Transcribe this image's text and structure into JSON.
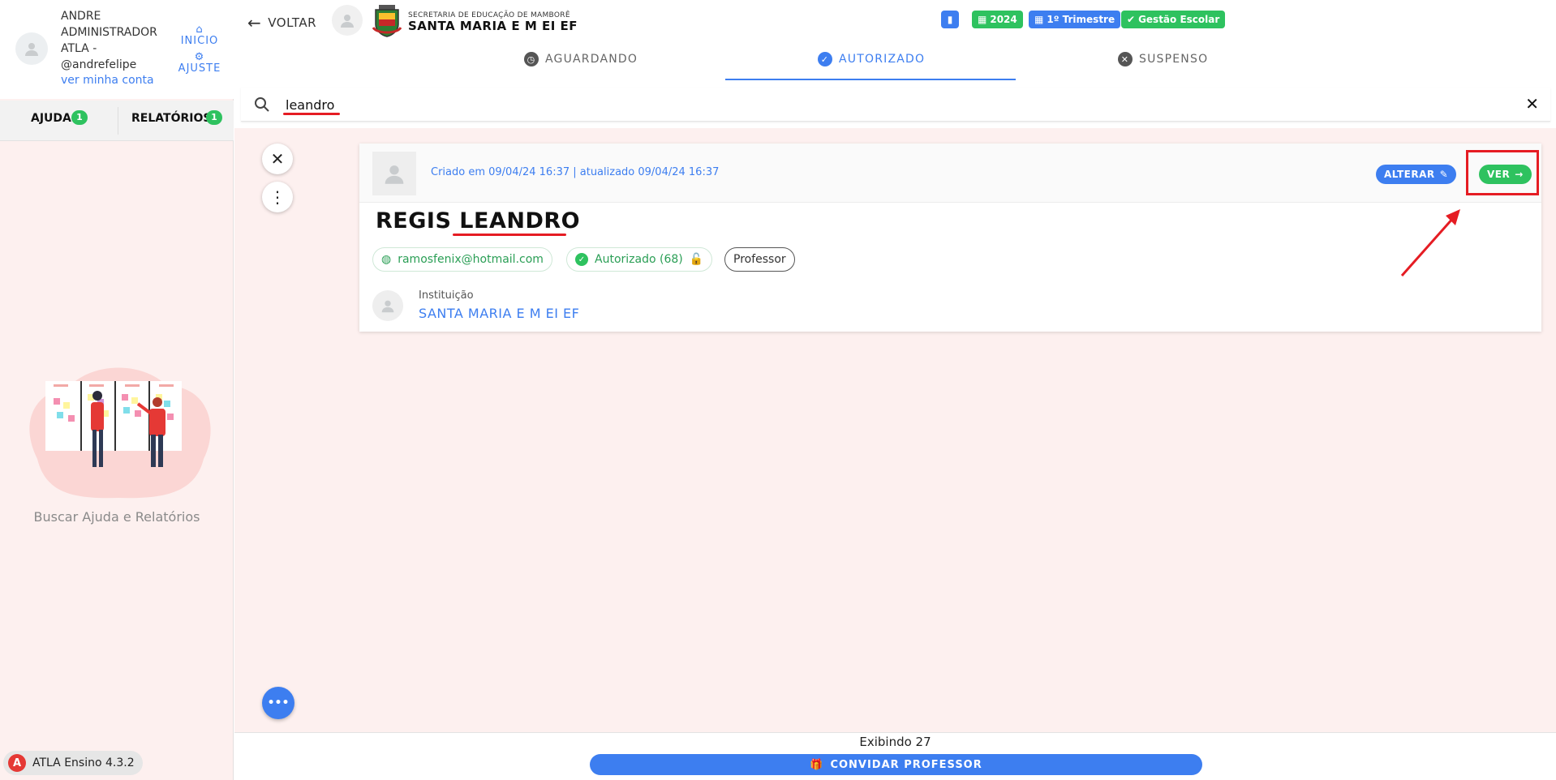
{
  "sidebar": {
    "user_name": "ANDRE ADMINISTRADOR ATLA - @andrefelipe",
    "account_link": "ver minha conta",
    "inicio_label": "INICIO",
    "ajuste_label": "AJUSTE",
    "tabs": [
      {
        "label": "AJUDA",
        "badge": "1"
      },
      {
        "label": "RELATÓRIOS",
        "badge": "1"
      }
    ],
    "help_text": "Buscar Ajuda e Relatórios",
    "version": "ATLA Ensino 4.3.2"
  },
  "header": {
    "back_label": "VOLTAR",
    "org_subtitle": "SECRETARIA DE EDUCAÇÃO DE MAMBORÊ",
    "org_name": "SANTA MARIA E M EI EF",
    "chips": [
      {
        "label": "",
        "icon": "bar-chart-icon",
        "color": "#3d7ef0"
      },
      {
        "label": "2024",
        "icon": "calendar-icon",
        "color": "#2ec25f"
      },
      {
        "label": "1º Trimestre",
        "icon": "calendar-icon",
        "color": "#3d7ef0"
      },
      {
        "label": "Gestão Escolar",
        "icon": "check-icon",
        "color": "#2ec25f"
      }
    ],
    "status_tabs": [
      {
        "label": "AGUARDANDO",
        "icon": "clock-icon"
      },
      {
        "label": "AUTORIZADO",
        "icon": "check-circle-icon",
        "active": true
      },
      {
        "label": "SUSPENSO",
        "icon": "x-circle-icon"
      }
    ]
  },
  "search": {
    "value": "leandro",
    "placeholder": ""
  },
  "card": {
    "dates": "Criado em 09/04/24 16:37 | atualizado 09/04/24 16:37",
    "alterar_label": "ALTERAR",
    "ver_label": "VER",
    "name_first": "REGIS",
    "name_last": "LEANDRO",
    "email": "ramosfenix@hotmail.com",
    "status": "Autorizado (68)",
    "role": "Professor",
    "institution_label": "Instituição",
    "institution_value": "SANTA MARIA E M EI EF"
  },
  "footer": {
    "count": "Exibindo 27",
    "invite_label": "CONVIDAR PROFESSOR"
  },
  "colors": {
    "accent": "#3d7ef0",
    "success": "#2ec25f",
    "highlight": "#e51c23",
    "background": "#fdf0ef"
  }
}
